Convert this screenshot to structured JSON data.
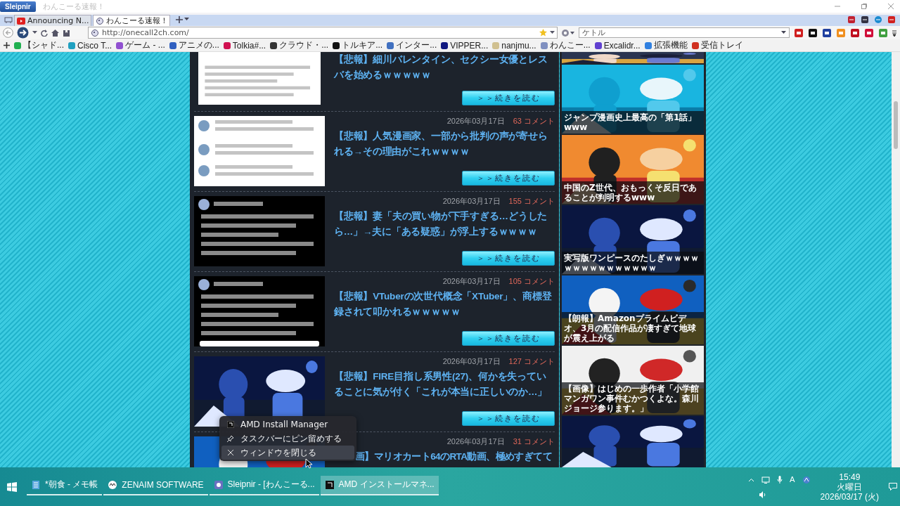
{
  "browser": {
    "logo": "Sleipnir",
    "page_title": "わんこーる速報！",
    "tabs": [
      {
        "label": "Announcing N...",
        "selected": false
      },
      {
        "label": "わんこーる速報！",
        "selected": true
      }
    ],
    "address": "http://onecall2ch.com/",
    "search": {
      "value": "ケトル"
    },
    "bookmarks": [
      "【シャド...",
      "Cisco T...",
      "ゲーム - ...",
      "アニメの...",
      "Tolkia#...",
      "クラウド・...",
      "トルキア...",
      "インター...",
      "VIPPER...",
      "nanjmu...",
      "わんこー...",
      "Excalidr...",
      "拡張機能",
      "受信トレイ"
    ]
  },
  "articles": [
    {
      "title": "【悲報】細川バレンタイン、セクシー女優とレスバを始めるｗｗｗｗｗ",
      "button": "＞＞続きを読む"
    },
    {
      "date": "2026年03月17日",
      "comments": "63 コメント",
      "title": "【悲報】人気漫画家、一部から批判の声が寄せられる→その理由がこれｗｗｗｗ",
      "button": "＞＞続きを読む"
    },
    {
      "date": "2026年03月17日",
      "comments": "155 コメント",
      "title": "【悲報】妻「夫の買い物が下手すぎる…どうしたら…」→夫に「ある疑惑」が浮上するｗｗｗｗ",
      "button": "＞＞続きを読む"
    },
    {
      "date": "2026年03月17日",
      "comments": "105 コメント",
      "title": "【悲報】VTuberの次世代概念「XTuber」、商標登録されて叩かれるｗｗｗｗｗ",
      "button": "＞＞続きを読む"
    },
    {
      "date": "2026年03月17日",
      "comments": "127 コメント",
      "title": "【悲報】FIRE目指し系男性(27)、何かを失っていることに気が付く「これが本当に正しいのか…」",
      "button": "＞＞続きを読む"
    },
    {
      "date": "2026年03月17日",
      "comments": "31 コメント",
      "title": "画】マリオカート64のRTA動画、極めすぎてて",
      "covered": true
    }
  ],
  "sidebar": [
    {
      "caption": "ジャンプ漫画史上最高の「第1話」www"
    },
    {
      "caption": "中国のZ世代、おもっくそ反日であることが判明するwww"
    },
    {
      "caption": "実写版ワンピースのたしぎｗｗｗｗｗｗｗｗｗｗｗｗｗｗｗ"
    },
    {
      "caption": "【朗報】Amazonプライムビデオ、3月の配信作品が凄すぎて地球が震え上がる"
    },
    {
      "caption": "【画像】はじめの一歩作者「小学館マンガワン事件むかつくよな。森川ジョージ参ります。」"
    }
  ],
  "context_menu": [
    {
      "kind": "app",
      "label": "AMD Install Manager",
      "selected": false
    },
    {
      "kind": "pin",
      "label": "タスクバーにピン留めする",
      "selected": false
    },
    {
      "kind": "close",
      "label": "ウィンドウを閉じる",
      "selected": true
    }
  ],
  "taskbar": {
    "items": [
      {
        "label": "*朝食 - メモ帳",
        "selected": false
      },
      {
        "label": "ZENAIM SOFTWARE",
        "selected": false
      },
      {
        "label": "Sleipnir - [わんこーる...",
        "selected": false
      },
      {
        "label": "AMD インストールマネ...",
        "selected": true
      }
    ],
    "ime": "A",
    "time": "15:49",
    "weekday": "火曜日",
    "date": "2026/03/17 (火)"
  }
}
